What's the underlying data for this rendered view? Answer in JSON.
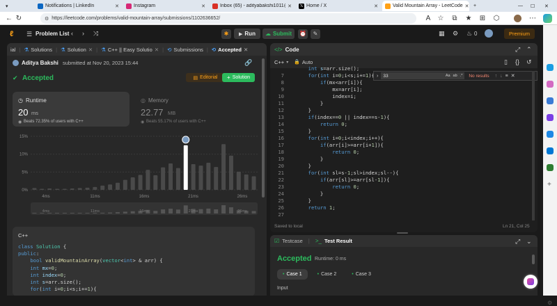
{
  "browser": {
    "tabs": [
      {
        "title": "Notifications | LinkedIn",
        "color": "#0a66c2"
      },
      {
        "title": "Instagram",
        "color": "#d62976"
      },
      {
        "title": "Inbox (65) - adityabakshi1011@...",
        "color": "#d93025"
      },
      {
        "title": "Home / X",
        "color": "#000000"
      },
      {
        "title": "Valid Mountain Array - LeetCode",
        "color": "#ffa116"
      }
    ],
    "url": "https://leetcode.com/problems/valid-mountain-array/submissions/1102636652/"
  },
  "topbar": {
    "problem_list": "Problem List",
    "run": "Run",
    "submit": "Submit",
    "streak": "0",
    "premium": "Premium"
  },
  "left_tabs": [
    {
      "label": "ial"
    },
    {
      "label": "Solutions"
    },
    {
      "label": "Solution"
    },
    {
      "label": "C++ || Easy Solution"
    },
    {
      "label": "Submissions"
    },
    {
      "label": "Accepted"
    }
  ],
  "submission": {
    "user": "Aditya Bakshi",
    "meta": "submitted at Nov 20, 2023 15:44",
    "status": "Accepted",
    "editorial": "Editorial",
    "solution": "Solution",
    "runtime_label": "Runtime",
    "runtime_value": "20",
    "runtime_unit": "ms",
    "runtime_beats": "Beats 72.35% of users with C++",
    "memory_label": "Memory",
    "memory_value": "22.77",
    "memory_unit": "MB",
    "memory_beats": "Beats 55.17% of users with C++"
  },
  "chart_data": {
    "type": "bar",
    "ylim": [
      0,
      15
    ],
    "yticks": [
      "15%",
      "10%",
      "5%",
      "0%"
    ],
    "xticks": [
      "4ms",
      "11ms",
      "16ms",
      "21ms",
      "26ms"
    ],
    "values": [
      0.5,
      0.3,
      0.4,
      0.3,
      0.3,
      0.4,
      0.5,
      0.6,
      0.8,
      1.2,
      1.5,
      2.0,
      2.8,
      3.5,
      4.2,
      5.6,
      4.1,
      6.3,
      7.4,
      6.1,
      12.5,
      7.2,
      6.8,
      7.6,
      6.4,
      12.8,
      9.6,
      5.1,
      4.3,
      3.8
    ],
    "highlight_index": 20
  },
  "left_code": {
    "lang": "C++",
    "lines": [
      [
        [
          "kw",
          "class "
        ],
        [
          "tp",
          "Solution "
        ],
        [
          "pl",
          "{"
        ]
      ],
      [
        [
          "kw",
          "public"
        ],
        [
          "pl",
          ":"
        ]
      ],
      [
        [
          "pl",
          "    "
        ],
        [
          "kw",
          "bool "
        ],
        [
          "fn",
          "validMountainArray"
        ],
        [
          "pl",
          "("
        ],
        [
          "tp",
          "vector"
        ],
        [
          "pl",
          "<"
        ],
        [
          "kw",
          "int"
        ],
        [
          "pl",
          "> & arr) {"
        ]
      ],
      [
        [
          "pl",
          "    "
        ],
        [
          "kw",
          "int "
        ],
        [
          "var",
          "mx"
        ],
        [
          "pl",
          "="
        ],
        [
          "num",
          "0"
        ],
        [
          "pl",
          ";"
        ]
      ],
      [
        [
          "pl",
          "    "
        ],
        [
          "kw",
          "int "
        ],
        [
          "var",
          "index"
        ],
        [
          "pl",
          "="
        ],
        [
          "num",
          "0"
        ],
        [
          "pl",
          ";"
        ]
      ],
      [
        [
          "pl",
          "    "
        ],
        [
          "kw",
          "int "
        ],
        [
          "var",
          "s"
        ],
        [
          "pl",
          "=arr.size();"
        ]
      ],
      [
        [
          "pl",
          "    "
        ],
        [
          "kw",
          "for"
        ],
        [
          "pl",
          "("
        ],
        [
          "kw",
          "int "
        ],
        [
          "pl",
          "i="
        ],
        [
          "num",
          "0"
        ],
        [
          "pl",
          ";i<s;i+="
        ],
        [
          "num",
          "1"
        ],
        [
          "pl",
          "){"
        ]
      ]
    ]
  },
  "editor": {
    "tab": "Code",
    "lang": "C++",
    "auto": "Auto",
    "find_value": "33",
    "find_flags": [
      "Aa",
      "ab",
      ".*"
    ],
    "no_results": "No results",
    "saved": "Saved to local",
    "cursor": "Ln 21, Col 25",
    "code": [
      {
        "n": "",
        "t": [
          [
            "pl",
            "    "
          ],
          [
            "kw",
            "int "
          ],
          [
            "var",
            "s"
          ],
          [
            "pl",
            "=arr.size();"
          ]
        ]
      },
      {
        "n": "7",
        "t": [
          [
            "pl",
            "    "
          ],
          [
            "kw",
            "for"
          ],
          [
            "pl",
            "("
          ],
          [
            "kw",
            "int "
          ],
          [
            "pl",
            "i="
          ],
          [
            "num",
            "0"
          ],
          [
            "pl",
            ";i<s;i+="
          ],
          [
            "num",
            "1"
          ],
          [
            "pl",
            "){"
          ]
        ]
      },
      {
        "n": "8",
        "t": [
          [
            "pl",
            "        "
          ],
          [
            "kw",
            "if"
          ],
          [
            "pl",
            "(mx<arr[i]){"
          ]
        ]
      },
      {
        "n": "9",
        "t": [
          [
            "pl",
            "            mx=arr[i];"
          ]
        ]
      },
      {
        "n": "10",
        "t": [
          [
            "pl",
            "            index=i;"
          ]
        ]
      },
      {
        "n": "11",
        "t": [
          [
            "pl",
            "        }"
          ]
        ]
      },
      {
        "n": "12",
        "t": [
          [
            "pl",
            "    }"
          ]
        ]
      },
      {
        "n": "13",
        "t": [
          [
            "pl",
            "    "
          ],
          [
            "kw",
            "if"
          ],
          [
            "pl",
            "(index=="
          ],
          [
            "num",
            "0"
          ],
          [
            "pl",
            " || index==s-"
          ],
          [
            "num",
            "1"
          ],
          [
            "pl",
            "){"
          ]
        ]
      },
      {
        "n": "14",
        "t": [
          [
            "pl",
            "        "
          ],
          [
            "kw",
            "return "
          ],
          [
            "num",
            "0"
          ],
          [
            "pl",
            ";"
          ]
        ]
      },
      {
        "n": "15",
        "t": [
          [
            "pl",
            "    }"
          ]
        ]
      },
      {
        "n": "16",
        "t": [
          [
            "pl",
            "    "
          ],
          [
            "kw",
            "for"
          ],
          [
            "pl",
            "("
          ],
          [
            "kw",
            "int "
          ],
          [
            "pl",
            "i="
          ],
          [
            "num",
            "0"
          ],
          [
            "pl",
            ";i<index;i++){"
          ]
        ]
      },
      {
        "n": "17",
        "t": [
          [
            "pl",
            "        "
          ],
          [
            "kw",
            "if"
          ],
          [
            "pl",
            "(arr[i]>=arr[i+"
          ],
          [
            "num",
            "1"
          ],
          [
            "pl",
            "]){"
          ]
        ]
      },
      {
        "n": "18",
        "t": [
          [
            "pl",
            "            "
          ],
          [
            "kw",
            "return "
          ],
          [
            "num",
            "0"
          ],
          [
            "pl",
            ";"
          ]
        ]
      },
      {
        "n": "19",
        "t": [
          [
            "pl",
            "        }"
          ]
        ]
      },
      {
        "n": "20",
        "t": [
          [
            "pl",
            "    }"
          ]
        ]
      },
      {
        "n": "21",
        "t": [
          [
            "pl",
            "    "
          ],
          [
            "kw",
            "for"
          ],
          [
            "pl",
            "("
          ],
          [
            "kw",
            "int "
          ],
          [
            "pl",
            "sl=s-"
          ],
          [
            "num",
            "1"
          ],
          [
            "pl",
            ";sl>index;sl--){"
          ]
        ]
      },
      {
        "n": "22",
        "t": [
          [
            "pl",
            "        "
          ],
          [
            "kw",
            "if"
          ],
          [
            "pl",
            "(arr[sl]>=arr[sl-"
          ],
          [
            "num",
            "1"
          ],
          [
            "pl",
            "]){"
          ]
        ]
      },
      {
        "n": "23",
        "t": [
          [
            "pl",
            "            "
          ],
          [
            "kw",
            "return "
          ],
          [
            "num",
            "0"
          ],
          [
            "pl",
            ";"
          ]
        ]
      },
      {
        "n": "24",
        "t": [
          [
            "pl",
            "        }"
          ]
        ]
      },
      {
        "n": "25",
        "t": [
          [
            "pl",
            "    }"
          ]
        ]
      },
      {
        "n": "26",
        "t": [
          [
            "pl",
            "    "
          ],
          [
            "kw",
            "return "
          ],
          [
            "num",
            "1"
          ],
          [
            "pl",
            ";"
          ]
        ]
      },
      {
        "n": "27",
        "t": []
      }
    ]
  },
  "result": {
    "testcase_tab": "Testcase",
    "result_tab": "Test Result",
    "status": "Accepted",
    "runtime": "Runtime: 0 ms",
    "cases": [
      "Case 1",
      "Case 2",
      "Case 3"
    ],
    "input_label": "Input"
  }
}
